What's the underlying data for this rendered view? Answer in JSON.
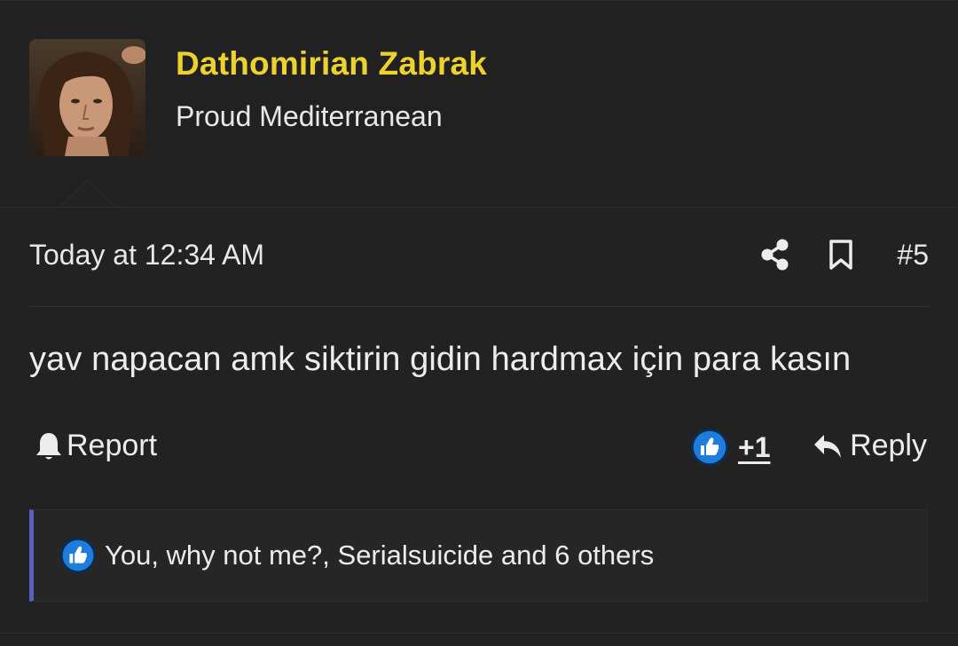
{
  "user": {
    "name": "Dathomirian Zabrak",
    "title": "Proud Mediterranean",
    "name_color": "#ecd12f",
    "avatar_icon": "user-avatar-photo"
  },
  "post": {
    "timestamp": "Today at 12:34 AM",
    "number": "#5",
    "message": "yav napacan amk siktirin gidin hardmax için para kasın",
    "share_icon": "share-icon",
    "bookmark_icon": "bookmark-icon"
  },
  "actions": {
    "report_label": "Report",
    "report_icon": "bell-icon",
    "like_icon": "thumbs-up-icon",
    "like_count": "+1",
    "reply_label": "Reply",
    "reply_icon": "reply-arrow-icon",
    "like_color": "#1e7cdc"
  },
  "reactions": {
    "text": "You, why not me?, Serialsuicide and 6 others",
    "accent_color": "#5b5fb8"
  }
}
